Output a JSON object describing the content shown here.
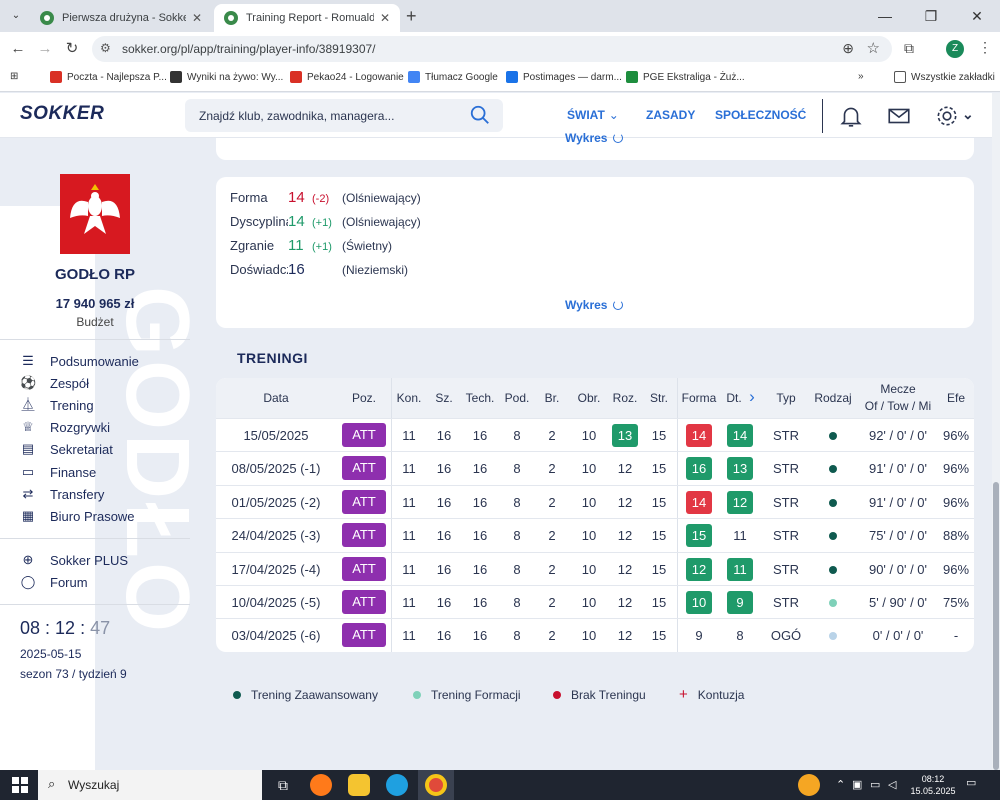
{
  "browser": {
    "tabs": [
      {
        "title": "Pierwsza drużyna - Sokker Man",
        "close": "✕"
      },
      {
        "title": "Training Report - Romuald Waj",
        "close": "✕"
      }
    ],
    "new_tab": "+",
    "window_controls": [
      "—",
      "❐",
      "✕"
    ],
    "url": "sokker.org/pl/app/training/player-info/38919307/",
    "profile_initial": "Z",
    "bookmarks": [
      {
        "label": "Poczta - Najlepsza P...",
        "color": "#d93025"
      },
      {
        "label": "Wyniki na żywo: Wy...",
        "color": "#333333"
      },
      {
        "label": "Pekao24 - Logowanie",
        "color": "#d93025"
      },
      {
        "label": "Tłumacz Google",
        "color": "#4285f4"
      },
      {
        "label": "Postimages — darm...",
        "color": "#1a73e8"
      },
      {
        "label": "PGE Ekstraliga - Żuż...",
        "color": "#1e8e3e"
      }
    ],
    "bookmarks_overflow": "»",
    "all_bookmarks": "Wszystkie zakładki"
  },
  "header": {
    "logo": "SOKKER",
    "search_placeholder": "Znajdź klub, zawodnika, managera...",
    "nav": [
      "ŚWIAT",
      "ZASADY",
      "SPOŁECZNOŚĆ"
    ],
    "accent": "#2a6fd6"
  },
  "sidebar": {
    "club_name": "GODŁO RP",
    "budget": "17 940 965 zł",
    "budget_label": "Budżet",
    "watermark": "GODŁO",
    "menu": [
      {
        "label": "Podsumowanie",
        "icon": "list-icon"
      },
      {
        "label": "Zespół",
        "icon": "ball-icon"
      },
      {
        "label": "Trening",
        "icon": "trening-icon"
      },
      {
        "label": "Rozgrywki",
        "icon": "trophy-icon"
      },
      {
        "label": "Sekretariat",
        "icon": "document-icon"
      },
      {
        "label": "Finanse",
        "icon": "card-icon"
      },
      {
        "label": "Transfery",
        "icon": "transfer-icon"
      },
      {
        "label": "Biuro Prasowe",
        "icon": "newspaper-icon"
      }
    ],
    "menu2": [
      {
        "label": "Sokker PLUS",
        "icon": "plus-circle-icon"
      },
      {
        "label": "Forum",
        "icon": "chat-icon"
      }
    ],
    "clock_h": "08",
    "clock_m": "12",
    "clock_s": "47",
    "date": "2025-05-15",
    "season": "sezon 73 / tydzień 9"
  },
  "top_card": {
    "wykres": "Wykres"
  },
  "stats_card": {
    "rows": [
      {
        "label": "Forma",
        "value": "14",
        "change": "(-2)",
        "desc": "(Olśniewający)",
        "color": "#c8102e"
      },
      {
        "label": "Dyscyplina",
        "value": "14",
        "change": "(+1)",
        "desc": "(Olśniewający)",
        "color": "#1f9a6a"
      },
      {
        "label": "Zgranie",
        "value": "11",
        "change": "(+1)",
        "desc": "(Świetny)",
        "color": "#1f9a6a"
      },
      {
        "label": "Doświadczenie",
        "value": "16",
        "change": "",
        "desc": "(Nieziemski)",
        "color": "#1c2a5a"
      }
    ],
    "wykres": "Wykres"
  },
  "training": {
    "title": "TRENINGI",
    "headers": {
      "data": "Data",
      "poz": "Poz.",
      "kon": "Kon.",
      "sz": "Sz.",
      "tech": "Tech.",
      "pod": "Pod.",
      "br": "Br.",
      "obr": "Obr.",
      "roz": "Roz.",
      "str": "Str.",
      "forma": "Forma",
      "dt": "Dt.",
      "next": "›",
      "typ": "Typ",
      "rodzaj": "Rodzaj",
      "mecze1": "Mecze",
      "mecze2": "Of / Tow / Mi",
      "efe": "Efe"
    },
    "rows": [
      {
        "date": "15/05/2025",
        "poz": "ATT",
        "kon": "11",
        "sz": "16",
        "tech": "16",
        "pod": "8",
        "br": "2",
        "obr": "10",
        "roz": "13",
        "roz_hl": "green",
        "str": "15",
        "forma": "14",
        "forma_hl": "red",
        "dt": "14",
        "dt_hl": "green",
        "typ": "STR",
        "dot": "#0f5a4f",
        "mecze": "92' / 0' / 0'",
        "efe": "96%"
      },
      {
        "date": "08/05/2025 (-1)",
        "poz": "ATT",
        "kon": "11",
        "sz": "16",
        "tech": "16",
        "pod": "8",
        "br": "2",
        "obr": "10",
        "roz": "12",
        "roz_hl": "",
        "str": "15",
        "forma": "16",
        "forma_hl": "green",
        "dt": "13",
        "dt_hl": "green",
        "typ": "STR",
        "dot": "#0f5a4f",
        "mecze": "91' / 0' / 0'",
        "efe": "96%"
      },
      {
        "date": "01/05/2025 (-2)",
        "poz": "ATT",
        "kon": "11",
        "sz": "16",
        "tech": "16",
        "pod": "8",
        "br": "2",
        "obr": "10",
        "roz": "12",
        "roz_hl": "",
        "str": "15",
        "forma": "14",
        "forma_hl": "red",
        "dt": "12",
        "dt_hl": "green",
        "typ": "STR",
        "dot": "#0f5a4f",
        "mecze": "91' / 0' / 0'",
        "efe": "96%"
      },
      {
        "date": "24/04/2025 (-3)",
        "poz": "ATT",
        "kon": "11",
        "sz": "16",
        "tech": "16",
        "pod": "8",
        "br": "2",
        "obr": "10",
        "roz": "12",
        "roz_hl": "",
        "str": "15",
        "forma": "15",
        "forma_hl": "green",
        "dt": "11",
        "dt_hl": "",
        "typ": "STR",
        "dot": "#0f5a4f",
        "mecze": "75' / 0' / 0'",
        "efe": "88%"
      },
      {
        "date": "17/04/2025 (-4)",
        "poz": "ATT",
        "kon": "11",
        "sz": "16",
        "tech": "16",
        "pod": "8",
        "br": "2",
        "obr": "10",
        "roz": "12",
        "roz_hl": "",
        "str": "15",
        "forma": "12",
        "forma_hl": "green",
        "dt": "11",
        "dt_hl": "green",
        "typ": "STR",
        "dot": "#0f5a4f",
        "mecze": "90' / 0' / 0'",
        "efe": "96%"
      },
      {
        "date": "10/04/2025 (-5)",
        "poz": "ATT",
        "kon": "11",
        "sz": "16",
        "tech": "16",
        "pod": "8",
        "br": "2",
        "obr": "10",
        "roz": "12",
        "roz_hl": "",
        "str": "15",
        "forma": "10",
        "forma_hl": "green",
        "dt": "9",
        "dt_hl": "green",
        "typ": "STR",
        "dot": "#7fd1b9",
        "mecze": "5' / 90' / 0'",
        "efe": "75%"
      },
      {
        "date": "03/04/2025 (-6)",
        "poz": "ATT",
        "kon": "11",
        "sz": "16",
        "tech": "16",
        "pod": "8",
        "br": "2",
        "obr": "10",
        "roz": "12",
        "roz_hl": "",
        "str": "15",
        "forma": "9",
        "forma_hl": "",
        "dt": "8",
        "dt_hl": "",
        "typ": "OGÓ",
        "dot": "#b9d3e8",
        "mecze": "0' / 0' / 0'",
        "efe": "-"
      }
    ],
    "colors": {
      "green": "#1f9a6a",
      "red": "#e23744",
      "pos": "#8e2fae"
    }
  },
  "legend": [
    {
      "label": "Trening Zaawansowany",
      "color": "#0f5a4f"
    },
    {
      "label": "Trening Formacji",
      "color": "#7fd1b9"
    },
    {
      "label": "Brak Treningu",
      "color": "#c8102e"
    },
    {
      "label": "Kontuzja",
      "color": "#c8102e"
    }
  ],
  "taskbar": {
    "search_placeholder": "Wyszukaj",
    "time": "08:12",
    "date": "15.05.2025"
  }
}
